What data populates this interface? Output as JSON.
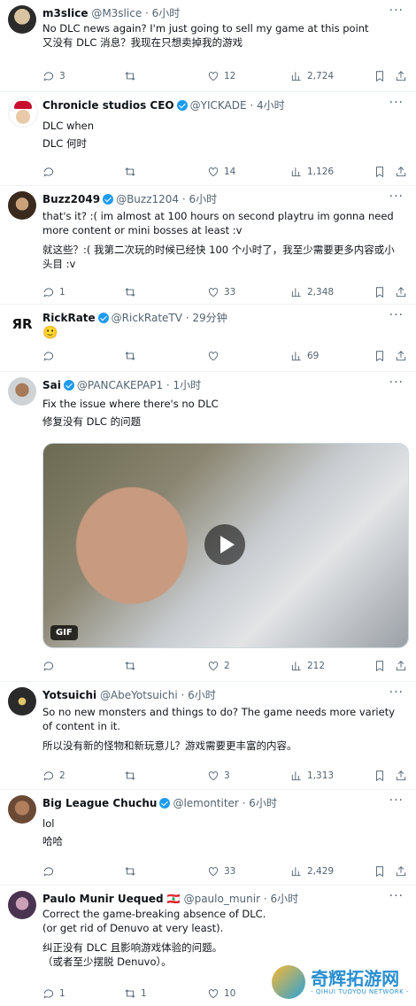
{
  "tweets": [
    {
      "name": "m3slice",
      "handle": "@M3slice",
      "time": "· 6小时",
      "verified": false,
      "lines": [
        "No DLC news again? I'm just going to sell my game at this point",
        "又没有 DLC 消息？我现在只想卖掉我的游戏"
      ],
      "replies": "3",
      "retweets": "",
      "likes": "12",
      "views": "2,724"
    },
    {
      "name": "Chronicle studios CEO",
      "handle": "@YICKADE · 4小时",
      "verified": true,
      "lines": [
        "DLC when",
        "DLC 何时"
      ],
      "replies": "",
      "retweets": "",
      "likes": "14",
      "views": "1,126"
    },
    {
      "name": "Buzz2049",
      "handle": "@Buzz1204 · 6小时",
      "verified": true,
      "lines": [
        "that's it? :( im almost at 100 hours on second playtru im gonna need more content or mini bosses at least :v",
        "就这些？:( 我第二次玩的时候已经快 100 个小时了，我至少需要更多内容或小头目 :v"
      ],
      "replies": "1",
      "retweets": "",
      "likes": "33",
      "views": "2,348"
    },
    {
      "name": "RickRate",
      "handle": "@RickRateTV · 29分钟",
      "verified": true,
      "lines": [
        "🙂"
      ],
      "replies": "",
      "retweets": "",
      "likes": "",
      "views": "69"
    },
    {
      "name": "Sai",
      "handle": "@PANCAKEPAP1 · 1小时",
      "verified": true,
      "lines": [
        "Fix the issue where there's no DLC",
        "修复没有 DLC 的问题"
      ],
      "gif_label": "GIF",
      "replies": "",
      "retweets": "",
      "likes": "2",
      "views": "212"
    },
    {
      "name": "Yotsuichi",
      "handle": "@AbeYotsuichi · 6小时",
      "verified": false,
      "lines": [
        "So no new monsters and things to do? The game needs more variety of content in it.",
        "所以没有新的怪物和新玩意儿？游戏需要更丰富的内容。"
      ],
      "replies": "2",
      "retweets": "",
      "likes": "3",
      "views": "1,313"
    },
    {
      "name": "Big League Chuchu",
      "handle": "@lemontiter · 6小时",
      "verified": true,
      "lines": [
        "lol",
        "哈哈"
      ],
      "replies": "",
      "retweets": "",
      "likes": "33",
      "views": "2,429"
    },
    {
      "name": "Paulo Munir Uequed 🇱🇧",
      "handle": "@paulo_munir · 6小时",
      "verified": false,
      "lines": [
        "Correct the game-breaking absence of DLC.",
        "(or get rid of Denuvo at very least).",
        "纠正没有 DLC 且影响游戏体验的问题。",
        "（或者至少摆脱 Denuvo）。"
      ],
      "replies": "1",
      "retweets": "1",
      "likes": "10",
      "views": ""
    }
  ],
  "more_label": "···",
  "watermark": {
    "title": "奇辉拓游网",
    "subtitle": "- QIHUI TUOYOU NETWORK -"
  },
  "colors": {
    "verified": "#1d9bf0",
    "text": "#0f1419",
    "muted": "#536471"
  }
}
